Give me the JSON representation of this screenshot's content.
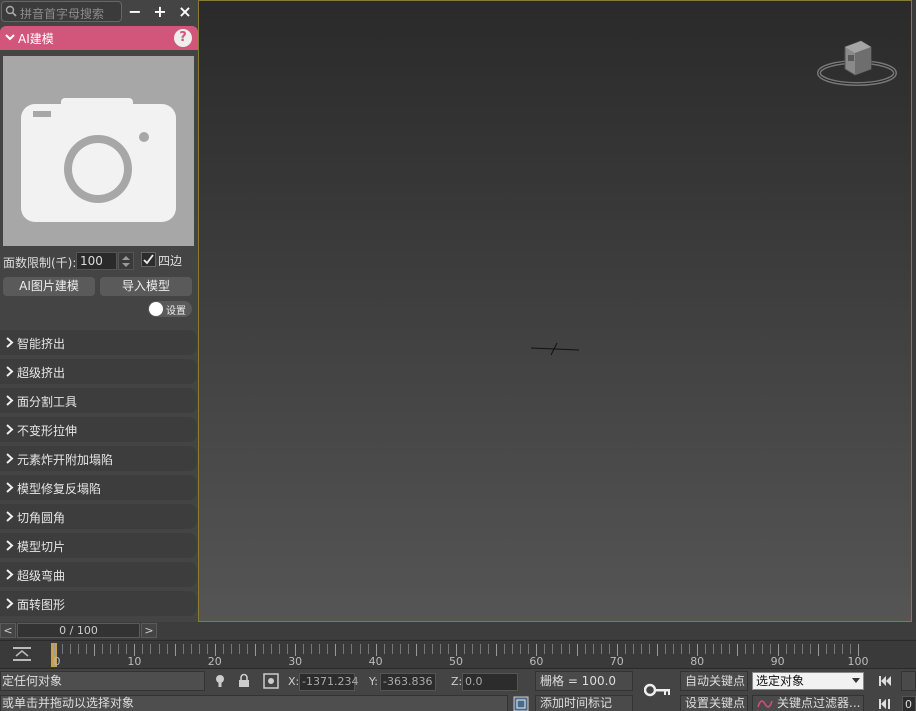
{
  "search": {
    "placeholder": "拼音首字母搜索"
  },
  "toolbar": {
    "minus_label": "−",
    "plus_label": "+",
    "close_label": "×"
  },
  "rollout": {
    "title": "AI建模",
    "help_label": "?"
  },
  "ai_model": {
    "face_limit_label": "面数限制(千):",
    "face_limit_value": "100",
    "quad_label": "四边",
    "quad_checked": true,
    "ai_image_button": "AI图片建模",
    "import_button": "导入模型",
    "settings_toggle_label": "设置"
  },
  "sections": [
    {
      "label": "智能挤出"
    },
    {
      "label": "超级挤出"
    },
    {
      "label": "面分割工具"
    },
    {
      "label": "不变形拉伸"
    },
    {
      "label": "元素炸开附加塌陷"
    },
    {
      "label": "模型修复反塌陷"
    },
    {
      "label": "切角圆角"
    },
    {
      "label": "模型切片"
    },
    {
      "label": "超级弯曲"
    },
    {
      "label": "面转图形"
    }
  ],
  "timeline": {
    "prev_label": "<",
    "next_label": ">",
    "slider_text": "0 / 100",
    "ticks": [
      "0",
      "10",
      "20",
      "30",
      "40",
      "50",
      "60",
      "70",
      "80",
      "90",
      "100"
    ]
  },
  "status": {
    "selection_text": "定任何对象",
    "prompt_text": "或单击并拖动以选择对象",
    "x_label": "X:",
    "x_value": "-1371.234",
    "y_label": "Y:",
    "y_value": "-363.836",
    "z_label": "Z:",
    "z_value": "0.0",
    "grid_text": "栅格 = 100.0",
    "add_time_tag": "添加时间标记",
    "auto_key": "自动关键点",
    "set_key": "设置关键点",
    "selected_object": "选定对象",
    "key_filters": "关键点过滤器...",
    "frame_value": "0"
  },
  "colors": {
    "accent": "#d2567c",
    "viewport_border": "#8a7a3a",
    "timeline_marker": "#c8a050"
  }
}
